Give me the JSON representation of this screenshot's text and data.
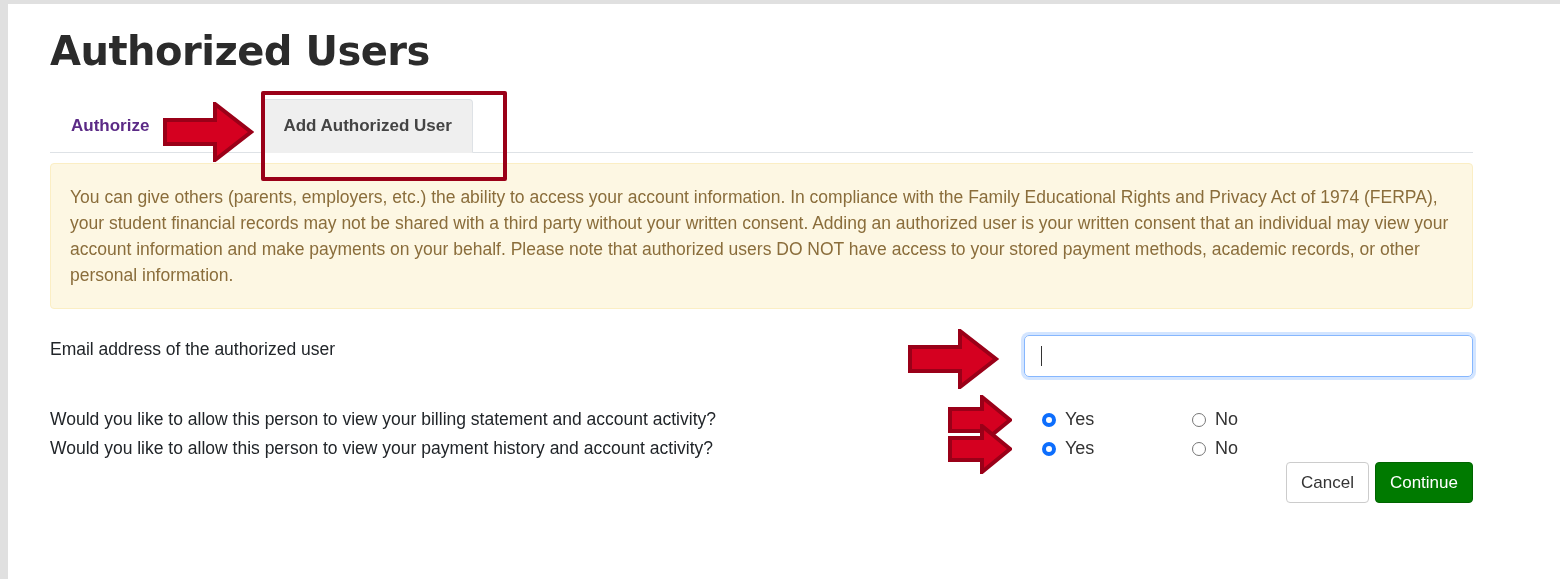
{
  "page": {
    "title": "Authorized Users"
  },
  "tabs": [
    {
      "label": "Authorize",
      "selected": false
    },
    {
      "label": "Add Authorized User",
      "selected": true
    }
  ],
  "notice": "You can give others (parents, employers, etc.) the ability to access your account information. In compliance with the Family Educational Rights and Privacy Act of 1974 (FERPA), your student financial records may not be shared with a third party without your written consent. Adding an authorized user is your written consent that an individual may view your account information and make payments on your behalf. Please note that authorized users DO NOT have access to your stored payment methods, academic records, or other personal information.",
  "email": {
    "label": "Email address of the authorized user",
    "focused": true
  },
  "questions": [
    {
      "text": "Would you like to allow this person to view your billing statement and account activity?",
      "options": [
        {
          "label": "Yes",
          "selected": true
        },
        {
          "label": "No",
          "selected": false
        }
      ]
    },
    {
      "text": "Would you like to allow this person to view your payment history and account activity?",
      "options": [
        {
          "label": "Yes",
          "selected": true
        },
        {
          "label": "No",
          "selected": false
        }
      ]
    }
  ],
  "buttons": [
    {
      "label": "Cancel",
      "kind": "secondary"
    },
    {
      "label": "Continue",
      "kind": "primary"
    }
  ]
}
